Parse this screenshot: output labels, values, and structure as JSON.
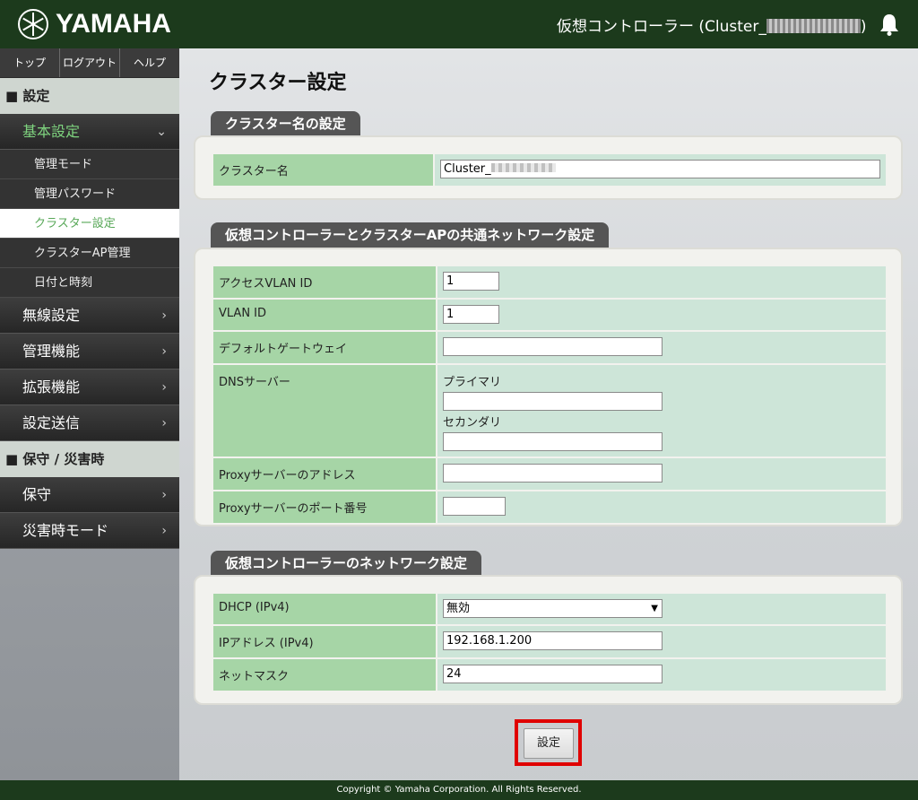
{
  "header": {
    "logo_text": "YAMAHA",
    "controller_label": "仮想コントローラー (Cluster_",
    "controller_suffix": ")"
  },
  "sidebar": {
    "topnav": [
      "トップ",
      "ログアウト",
      "ヘルプ"
    ],
    "section_settings": "■ 設定",
    "basic_settings": "基本設定",
    "sub_items": [
      "管理モード",
      "管理パスワード",
      "クラスター設定",
      "クラスターAP管理",
      "日付と時刻"
    ],
    "main_items": [
      "無線設定",
      "管理機能",
      "拡張機能",
      "設定送信"
    ],
    "section_maintenance": "■ 保守 / 災害時",
    "maint_items": [
      "保守",
      "災害時モード"
    ]
  },
  "page": {
    "title": "クラスター設定",
    "section1": {
      "tab": "クラスター名の設定",
      "rows": [
        {
          "label": "クラスター名",
          "value": "Cluster_"
        }
      ]
    },
    "section2": {
      "tab": "仮想コントローラーとクラスターAPの共通ネットワーク設定",
      "access_vlan_label": "アクセスVLAN ID",
      "access_vlan_value": "1",
      "vlan_label": "VLAN ID",
      "vlan_value": "1",
      "gateway_label": "デフォルトゲートウェイ",
      "gateway_value": "",
      "dns_label": "DNSサーバー",
      "dns_primary_label": "プライマリ",
      "dns_primary_value": "",
      "dns_secondary_label": "セカンダリ",
      "dns_secondary_value": "",
      "proxy_addr_label": "Proxyサーバーのアドレス",
      "proxy_addr_value": "",
      "proxy_port_label": "Proxyサーバーのポート番号",
      "proxy_port_value": ""
    },
    "section3": {
      "tab": "仮想コントローラーのネットワーク設定",
      "dhcp_label": "DHCP (IPv4)",
      "dhcp_value": "無効",
      "ip_label": "IPアドレス (IPv4)",
      "ip_value": "192.168.1.200",
      "mask_label": "ネットマスク",
      "mask_value": "24"
    },
    "submit_label": "設定"
  },
  "footer": {
    "copyright": "Copyright © Yamaha Corporation. All Rights Reserved."
  }
}
